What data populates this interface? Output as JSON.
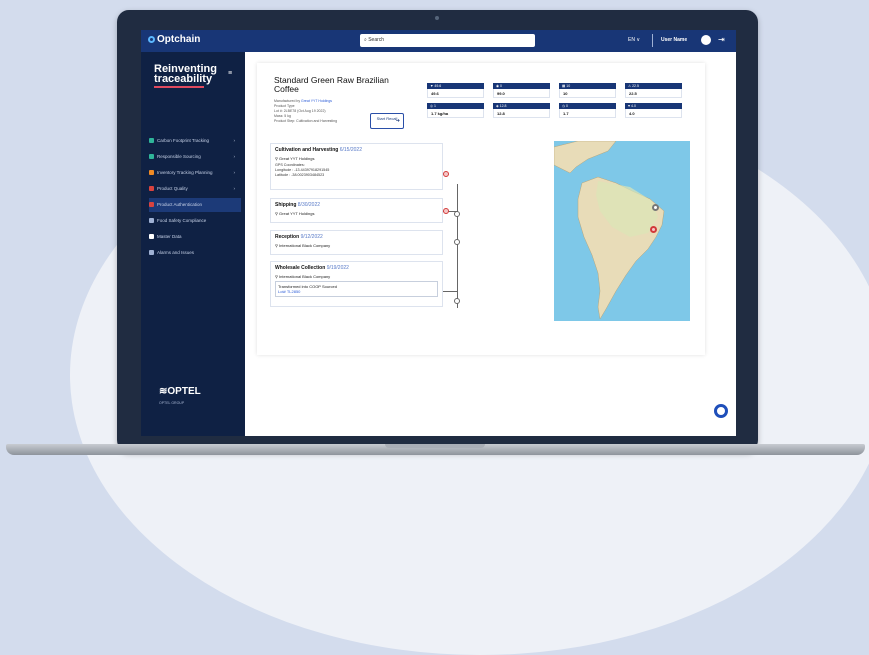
{
  "header": {
    "app_name": "Optchain",
    "search_placeholder": "Search",
    "language": "EN ∨",
    "user_name": "User Name"
  },
  "sidebar": {
    "brand_line1": "Reinventing",
    "brand_line2": "traceability",
    "items": [
      {
        "label": "Carbon Footprint Tracking",
        "color": "#2fb59a",
        "has_chevron": true
      },
      {
        "label": "Responsible Sourcing",
        "color": "#2fb59a",
        "has_chevron": true
      },
      {
        "label": "Inventory Tracking Planning",
        "color": "#f08a24",
        "has_chevron": true
      },
      {
        "label": "Product Quality",
        "color": "#d9433f",
        "has_chevron": true
      },
      {
        "label": "Product Authentication",
        "color": "#d9433f",
        "has_chevron": false,
        "active": true
      },
      {
        "label": "Food Safety Compliance",
        "color": "#9fb1d4",
        "has_chevron": false
      },
      {
        "label": "Master Data",
        "color": "#ffffff",
        "has_chevron": false
      },
      {
        "label": "Alarms and Issues",
        "color": "#9fb1d4",
        "has_chevron": false
      }
    ],
    "footer_logo": "OPTEL",
    "footer_sub": "OPTEL GROUP"
  },
  "product": {
    "title": "Standard Green Raw Brazilian Coffee",
    "manufacturer": "Great YYT Holdings",
    "product_type": "Product Type",
    "lot": "Lot #: 2LBE78 (Oct Aug 19 2022)",
    "mass": "Mass: 5 kg",
    "product_step": "Product Step: Cultivation and Harvesting",
    "recall_label": "Start Recall"
  },
  "kpis": [
    {
      "header": "▼ 49.6",
      "value": "49.6"
    },
    {
      "header": "◉ 0",
      "value": "99.0"
    },
    {
      "header": "▦ 10",
      "value": "10"
    },
    {
      "header": "⚠ 22.5",
      "value": "22.5"
    },
    {
      "header": "◎ 1",
      "value": "1.7 kg/ha"
    },
    {
      "header": "◈ 12.8",
      "value": "12.8"
    },
    {
      "header": "◷ 0",
      "value": "1.7"
    },
    {
      "header": "♥ 4.0",
      "value": "4.0"
    }
  ],
  "events": [
    {
      "title": "Cultivation and Harvesting",
      "date": "6/15/2022",
      "company": "Great YYT Holdings",
      "gps_title": "GPS Coordinates:",
      "gps_lon": "Longitude : -13.44397918291545",
      "gps_lat": "Latitude : -38.0023903484523"
    },
    {
      "title": "Shipping",
      "date": "8/30/2022",
      "company": "Great YYT Holdings"
    },
    {
      "title": "Reception",
      "date": "9/12/2022",
      "company": "International Black Company"
    },
    {
      "title": "Wholesale Collection",
      "date": "9/19/2022",
      "company": "International Black Company",
      "note": "Transformed into COOP Sourced",
      "note_link": "Lot# TL2850"
    }
  ]
}
